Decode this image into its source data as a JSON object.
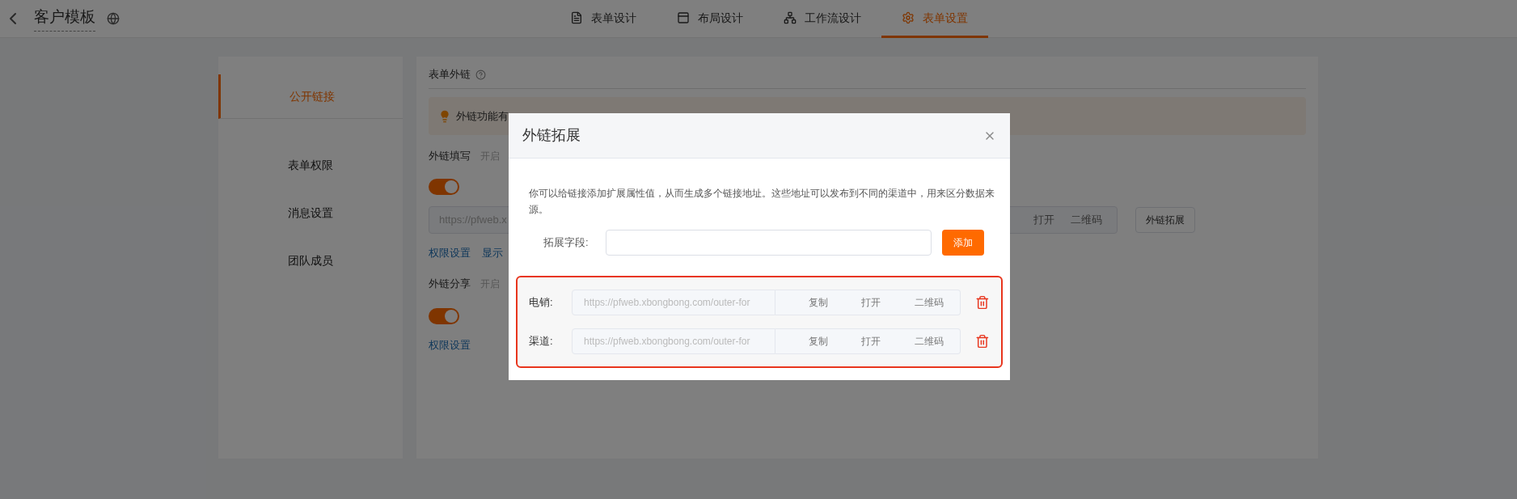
{
  "header": {
    "title": "客户模板",
    "tabs": [
      {
        "label": "表单设计",
        "selected": false
      },
      {
        "label": "布局设计",
        "selected": false
      },
      {
        "label": "工作流设计",
        "selected": false
      },
      {
        "label": "表单设置",
        "selected": true
      }
    ]
  },
  "nav": [
    {
      "label": "公开链接",
      "selected": true
    },
    {
      "label": "表单权限",
      "selected": false
    },
    {
      "label": "消息设置",
      "selected": false
    },
    {
      "label": "团队成员",
      "selected": false
    }
  ],
  "section": {
    "title": "表单外链",
    "banner": "外链功能有",
    "fill": {
      "title": "外链填写",
      "hint": "开启",
      "on": true,
      "url": "https://pfweb.x",
      "actions": [
        "打开",
        "二维码"
      ],
      "extend_button": "外链拓展",
      "links": [
        "权限设置",
        "显示"
      ]
    },
    "share": {
      "title": "外链分享",
      "hint": "开启",
      "on": true,
      "links": [
        "权限设置"
      ]
    }
  },
  "dialog": {
    "title": "外链拓展",
    "description": "你可以给链接添加扩展属性值，从而生成多个链接地址。这些地址可以发布到不同的渠道中，用来区分数据来源。",
    "field_label": "拓展字段:",
    "add_button": "添加",
    "entries": [
      {
        "label": "电销:",
        "url": "https://pfweb.xbongbong.com/outer-for",
        "actions": [
          "复制",
          "打开",
          "二维码"
        ]
      },
      {
        "label": "渠道:",
        "url": "https://pfweb.xbongbong.com/outer-for",
        "actions": [
          "复制",
          "打开",
          "二维码"
        ]
      }
    ]
  }
}
